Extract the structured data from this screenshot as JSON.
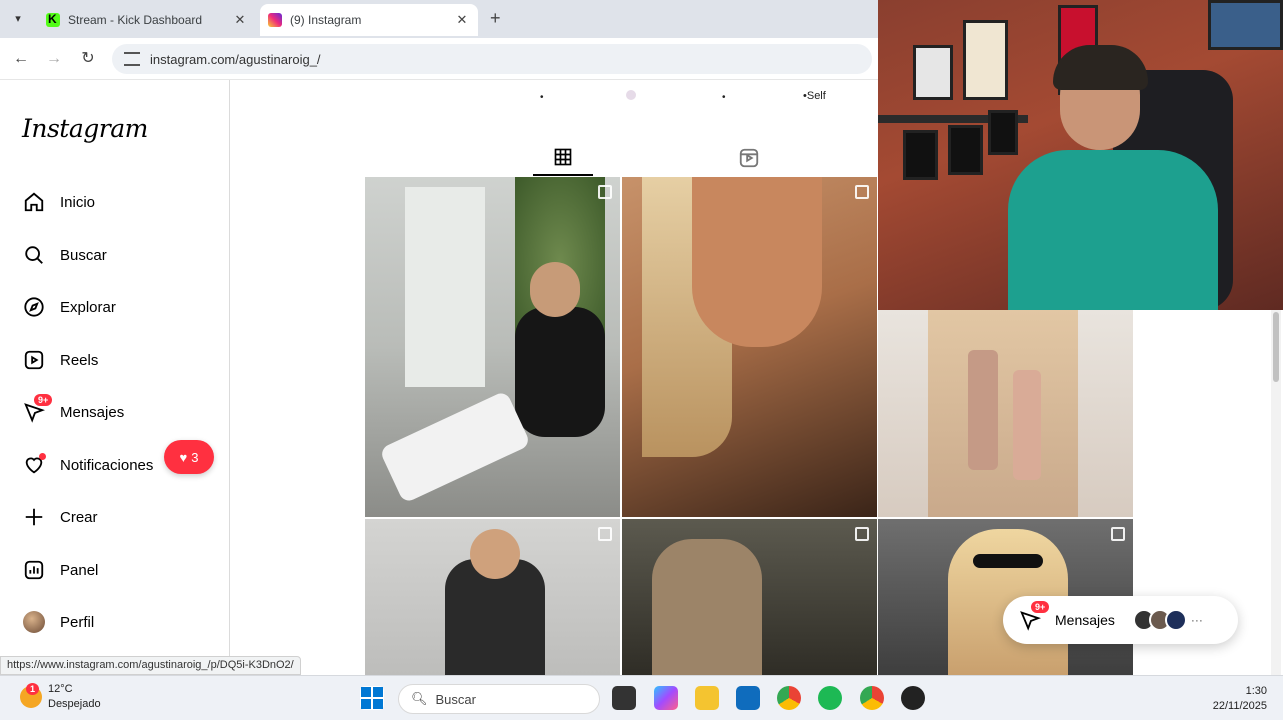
{
  "browser": {
    "tabs": [
      {
        "label": "Stream - Kick Dashboard",
        "active": false
      },
      {
        "label": "(9) Instagram",
        "active": true
      }
    ],
    "url": "instagram.com/agustinaroig_/",
    "status_url": "https://www.instagram.com/agustinaroig_/p/DQ5i-K3DnO2/"
  },
  "instagram": {
    "logo": "Instagram",
    "nav": [
      {
        "label": "Inicio",
        "icon": "home-icon"
      },
      {
        "label": "Buscar",
        "icon": "search-icon"
      },
      {
        "label": "Explorar",
        "icon": "compass-icon"
      },
      {
        "label": "Reels",
        "icon": "reels-icon"
      },
      {
        "label": "Mensajes",
        "icon": "messenger-icon",
        "badge": "9+"
      },
      {
        "label": "Notificaciones",
        "icon": "heart-icon"
      },
      {
        "label": "Crear",
        "icon": "plus-icon"
      },
      {
        "label": "Panel",
        "icon": "chart-icon"
      },
      {
        "label": "Perfil",
        "icon": "avatar"
      }
    ],
    "notification_pill_count": "3",
    "highlight_labels": [
      "•Self"
    ],
    "floating_messages": {
      "label": "Mensajes",
      "badge": "9+",
      "more": "···"
    },
    "accent": "#ff3040"
  },
  "taskbar": {
    "weather_temp": "12°C",
    "weather_desc": "Despejado",
    "weather_badge": "1",
    "search_placeholder": "Buscar",
    "time": "1:30",
    "date": "22/11/2025"
  }
}
